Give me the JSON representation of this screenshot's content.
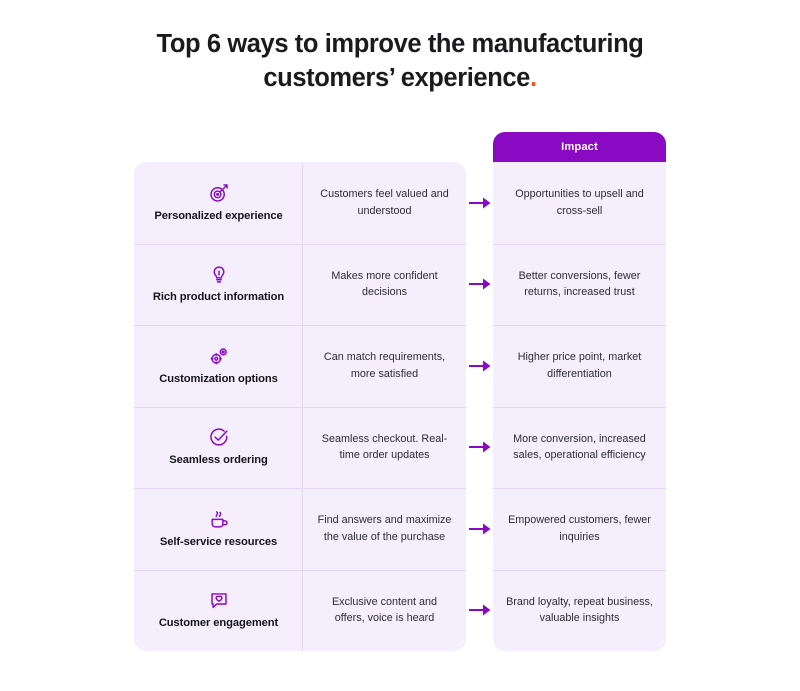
{
  "title": {
    "line1": "Top 6 ways to improve the manufacturing",
    "line2": "customers’ experience",
    "period": ".",
    "accent_color": "#f4541f"
  },
  "colors": {
    "header_purple": "#8a0ac4",
    "cell_background": "#f5efFD",
    "divider": "#e5d6f8",
    "icon_purple": "#8a0ac4",
    "arrow_purple": "#8a0ac4",
    "title_text": "#1b1b1f",
    "body_text": "#2d2d33"
  },
  "table": {
    "impact_header": "Impact",
    "rows": [
      {
        "icon": "target-arrow-icon",
        "feature": "Personalized experience",
        "benefit": "Customers feel valued and understood",
        "arrow": "arrow-right-icon",
        "impact": "Opportunities to upsell and cross-sell"
      },
      {
        "icon": "lightbulb-icon",
        "feature": "Rich product information",
        "benefit": "Makes more confident decisions",
        "arrow": "arrow-right-icon",
        "impact": "Better conversions, fewer returns, increased trust"
      },
      {
        "icon": "gears-icon",
        "feature": "Customization options",
        "benefit": "Can match requirements, more satisfied",
        "arrow": "arrow-right-icon",
        "impact": "Higher price point, market differentiation"
      },
      {
        "icon": "check-circle-icon",
        "feature": "Seamless ordering",
        "benefit": "Seamless checkout. Real-time order updates",
        "arrow": "arrow-right-icon",
        "impact": "More conversion, increased sales, operational efficiency"
      },
      {
        "icon": "coffee-cup-icon",
        "feature": "Self-service resources",
        "benefit": "Find answers and maximize the value of the purchase",
        "arrow": "arrow-right-icon",
        "impact": "Empowered customers, fewer inquiries"
      },
      {
        "icon": "chat-heart-icon",
        "feature": "Customer engagement",
        "benefit": "Exclusive content and offers, voice is heard",
        "arrow": "arrow-right-icon",
        "impact": "Brand loyalty, repeat business, valuable insights"
      }
    ]
  }
}
